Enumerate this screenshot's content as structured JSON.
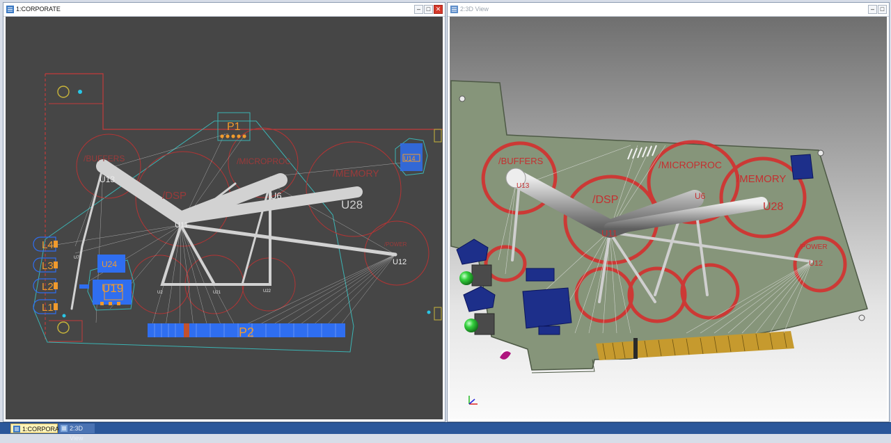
{
  "left_window": {
    "title": "1:CORPORATE",
    "icon": "layout-view-icon",
    "buttons": [
      "minimize",
      "maximize",
      "close"
    ]
  },
  "right_window": {
    "title": "2:3D View",
    "icon": "3d-view-icon",
    "buttons": [
      "minimize",
      "maximize"
    ]
  },
  "layout": {
    "components": [
      "P1",
      "/BUFFERS",
      "U13",
      "/DSP",
      "U11",
      "/MICROPROC",
      "U6",
      "/MEMORY",
      "U28",
      "/POWER",
      "U12",
      "U14",
      "U19",
      "U24",
      "U2",
      "U22",
      "L1",
      "L2",
      "L3",
      "L4",
      "P2",
      "U7",
      "U21"
    ],
    "colors": {
      "canvas": "#464646",
      "outline": "#c23b3b",
      "ratsnest": "#d7d7d7",
      "pads": "#f09a2d",
      "smd": "#2f6ef0",
      "keepout": "#3bb4b4"
    }
  },
  "view3d": {
    "labels": [
      "/BUFFERS",
      "U13",
      "/DSP",
      "U11",
      "/MICROPROC",
      "U6",
      "/MEMORY",
      "U28",
      "/POWER",
      "U12"
    ],
    "colors": {
      "board": "#8c9a7d",
      "rings": "#d92a2a",
      "trunk": "#a9a9a9",
      "parts": "#1d2f8a",
      "led": "#2ec83a"
    }
  },
  "taskbar": {
    "tabs": [
      {
        "label": "1:CORPORATE",
        "active": true
      },
      {
        "label": "2:3D View",
        "active": false
      }
    ]
  }
}
